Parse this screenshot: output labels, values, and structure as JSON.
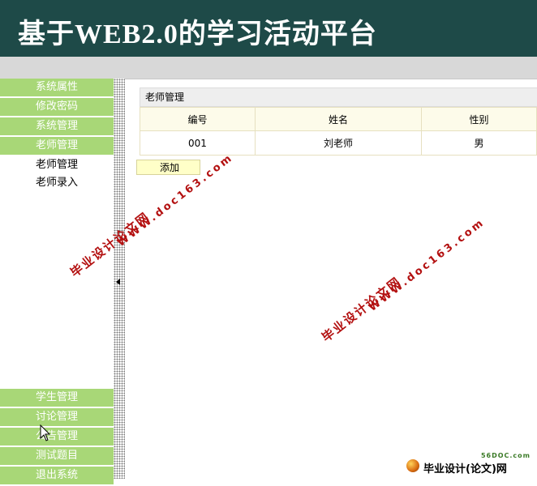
{
  "header": {
    "title_a": "基于",
    "title_b": "WEB2.0",
    "title_c": "的学习活动平台"
  },
  "sidebar": {
    "top_items": [
      {
        "label": "系统属性"
      },
      {
        "label": "修改密码"
      },
      {
        "label": "系统管理"
      },
      {
        "label": "老师管理"
      }
    ],
    "sub_items": [
      {
        "label": "老师管理"
      },
      {
        "label": "老师录入"
      }
    ],
    "bottom_items": [
      {
        "label": "学生管理"
      },
      {
        "label": "讨论管理"
      },
      {
        "label": "公告管理"
      },
      {
        "label": "测试题目"
      },
      {
        "label": "退出系统"
      }
    ]
  },
  "panel": {
    "title": "老师管理",
    "columns": [
      "编号",
      "姓名",
      "性别"
    ],
    "rows": [
      [
        "001",
        "刘老师",
        "男"
      ]
    ],
    "add_label": "添加"
  },
  "watermarks": {
    "line1": "毕业设计论文网",
    "line2": "WWW.doc163.com"
  },
  "brand": {
    "site": "56DOC.com",
    "text": "毕业设计(论文)网"
  },
  "colors": {
    "header_bg": "#1e4a48",
    "menu_green": "#a8d777",
    "watermark": "#b31010"
  }
}
